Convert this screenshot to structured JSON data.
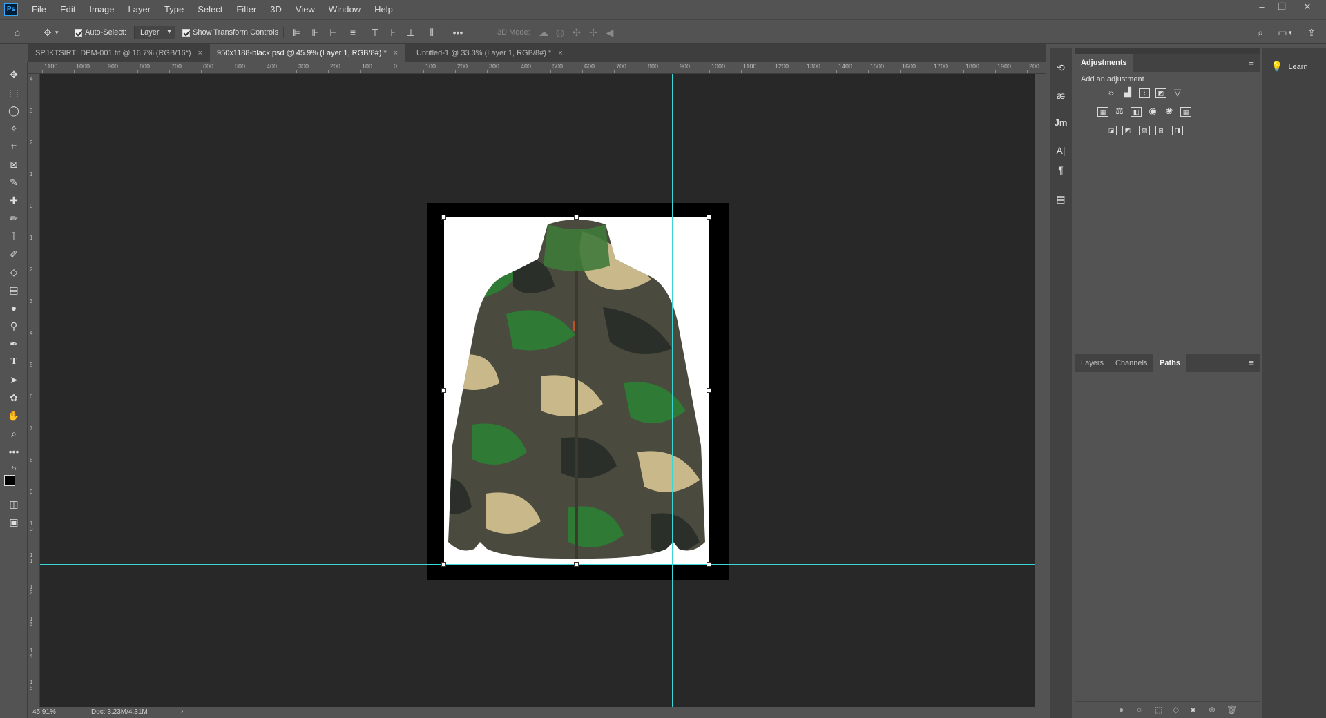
{
  "app": {
    "logo_text": "Ps"
  },
  "menu": [
    "File",
    "Edit",
    "Image",
    "Layer",
    "Type",
    "Select",
    "Filter",
    "3D",
    "View",
    "Window",
    "Help"
  ],
  "window_controls": {
    "minimize": "–",
    "restore": "❐",
    "close": "✕"
  },
  "options_bar": {
    "auto_select_label": "Auto-Select:",
    "auto_select_checked": true,
    "auto_select_target": "Layer",
    "show_transform_label": "Show Transform Controls",
    "show_transform_checked": true,
    "three_d_mode_label": "3D Mode:"
  },
  "tabs": [
    {
      "label": "SPJKTSIRTLDPM-001.tif @ 16.7% (RGB/16*)",
      "close": "×",
      "active": false
    },
    {
      "label": "950x1188-black.psd @ 45.9% (Layer 1, RGB/8#) *",
      "close": "×",
      "active": true
    },
    {
      "label": "Untitled-1 @ 33.3% (Layer 1, RGB/8#) *",
      "close": "×",
      "active": false
    }
  ],
  "ruler_h_labels": [
    "1100",
    "1000",
    "900",
    "800",
    "700",
    "600",
    "500",
    "400",
    "300",
    "200",
    "100",
    "0",
    "100",
    "200",
    "300",
    "400",
    "500",
    "600",
    "700",
    "800",
    "900",
    "1000",
    "1100",
    "1200",
    "1300",
    "1400",
    "1500",
    "1600",
    "1700",
    "1800",
    "1900",
    "200"
  ],
  "ruler_v_labels": [
    "4",
    "3",
    "2",
    "1",
    "0",
    "1",
    "2",
    "3",
    "4",
    "5",
    "6",
    "7",
    "8",
    "9",
    "10",
    "11",
    "12",
    "13",
    "14",
    "15",
    "16"
  ],
  "status": {
    "zoom": "45.91%",
    "doc": "Doc: 3.23M/4.31M",
    "arrow": "›"
  },
  "panels": {
    "adjustments": {
      "title": "Adjustments",
      "subtitle": "Add an adjustment"
    },
    "layers_tabs": [
      "Layers",
      "Channels",
      "Paths"
    ],
    "active_layers_tab": "Paths",
    "learn_label": "Learn"
  },
  "dock_icons": [
    "history-icon",
    "character-style-icon",
    "glyphs-icon",
    "character-icon",
    "paragraph-icon",
    "libraries-icon"
  ],
  "dock_glyphs": [
    "⟲",
    "ꬱ",
    "Jm",
    "A|",
    "¶",
    "▤"
  ],
  "colors": {
    "guide": "#3ad6d6",
    "canvas_bg": "#282828",
    "ui_bg": "#535353",
    "panel_dark": "#3b3b3b"
  }
}
